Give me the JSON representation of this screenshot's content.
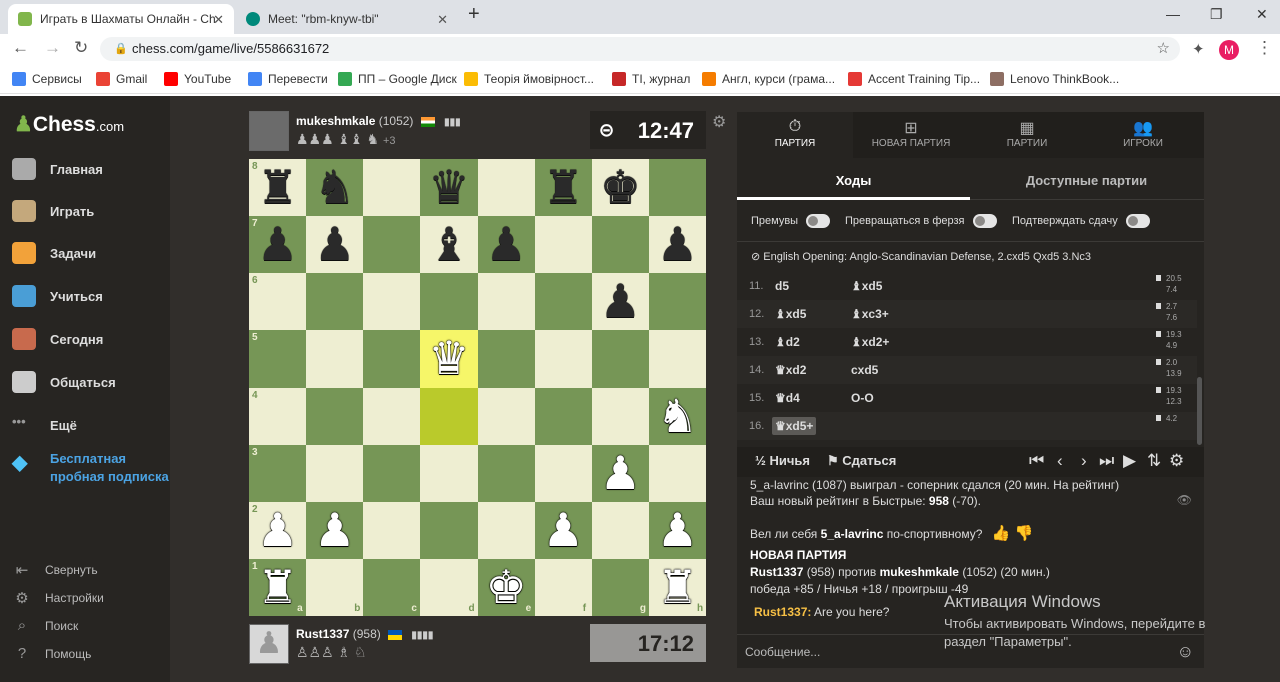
{
  "browser": {
    "tabs": [
      {
        "title": "Играть в Шахматы Онлайн - Ch",
        "close": "✕"
      },
      {
        "title": "Meet: \"rbm-knyw-tbi\"",
        "close": "✕"
      }
    ],
    "new_tab": "+",
    "url": "chess.com/game/live/5586631672",
    "profile_initial": "M",
    "bookmarks": [
      "Сервисы",
      "Gmail",
      "YouTube",
      "Перевести",
      "ПП – Google Диск",
      "Теорія ймовірност...",
      "TI, журнал",
      "Англ, курси (грама...",
      "Accent Training Tip...",
      "Lenovo ThinkBook..."
    ],
    "bookmark_colors": [
      "#4285f4",
      "#ea4335",
      "#ff0000",
      "#4285f4",
      "#34a853",
      "#fbbc04",
      "#c62828",
      "#f57c00",
      "#e53935",
      "#8d6e63"
    ]
  },
  "sidebar": {
    "logo_main": "Chess",
    "logo_suffix": ".com",
    "items": [
      {
        "label": "Главная",
        "color": "#aaaaaa"
      },
      {
        "label": "Играть",
        "color": "#c4a87c"
      },
      {
        "label": "Задачи",
        "color": "#f2a23a"
      },
      {
        "label": "Учиться",
        "color": "#4a9ed6"
      },
      {
        "label": "Сегодня",
        "color": "#c86a4d"
      },
      {
        "label": "Общаться",
        "color": "#cccccc"
      },
      {
        "label": "Ещё",
        "color": "#999999"
      }
    ],
    "promo": [
      "Бесплатная",
      "пробная подписка"
    ],
    "bottom": [
      "Свернуть",
      "Настройки",
      "Поиск",
      "Помощь"
    ]
  },
  "top_player": {
    "name": "mukeshmkale",
    "rating": "(1052)",
    "captured": "♟♟♟ ♝♝ ♞",
    "advantage": "+3",
    "clock": "12:47"
  },
  "bottom_player": {
    "name": "Rust1337",
    "rating": "(958)",
    "captured": "♙♙♙ ♗ ♘",
    "clock": "17:12"
  },
  "board": {
    "ranks": [
      "8",
      "7",
      "6",
      "5",
      "4",
      "3",
      "2",
      "1"
    ],
    "files": [
      "a",
      "b",
      "c",
      "d",
      "e",
      "f",
      "g",
      "h"
    ],
    "highlights": [
      "d5",
      "d4"
    ],
    "pieces": [
      {
        "sq": "a8",
        "p": "♜",
        "c": "b"
      },
      {
        "sq": "b8",
        "p": "♞",
        "c": "b"
      },
      {
        "sq": "d8",
        "p": "♛",
        "c": "b"
      },
      {
        "sq": "f8",
        "p": "♜",
        "c": "b"
      },
      {
        "sq": "g8",
        "p": "♚",
        "c": "b"
      },
      {
        "sq": "a7",
        "p": "♟",
        "c": "b"
      },
      {
        "sq": "b7",
        "p": "♟",
        "c": "b"
      },
      {
        "sq": "d7",
        "p": "♝",
        "c": "b"
      },
      {
        "sq": "e7",
        "p": "♟",
        "c": "b"
      },
      {
        "sq": "h7",
        "p": "♟",
        "c": "b"
      },
      {
        "sq": "g6",
        "p": "♟",
        "c": "b"
      },
      {
        "sq": "d5",
        "p": "♛",
        "c": "w"
      },
      {
        "sq": "h4",
        "p": "♞",
        "c": "w"
      },
      {
        "sq": "g3",
        "p": "♟",
        "c": "w"
      },
      {
        "sq": "a2",
        "p": "♟",
        "c": "w"
      },
      {
        "sq": "b2",
        "p": "♟",
        "c": "w"
      },
      {
        "sq": "f2",
        "p": "♟",
        "c": "w"
      },
      {
        "sq": "h2",
        "p": "♟",
        "c": "w"
      },
      {
        "sq": "a1",
        "p": "♜",
        "c": "w"
      },
      {
        "sq": "e1",
        "p": "♚",
        "c": "w"
      },
      {
        "sq": "h1",
        "p": "♜",
        "c": "w"
      }
    ]
  },
  "panel": {
    "tabs": [
      {
        "label": "ПАРТИЯ",
        "icon": "⏱"
      },
      {
        "label": "НОВАЯ ПАРТИЯ",
        "icon": "⊞"
      },
      {
        "label": "ПАРТИИ",
        "icon": "▦"
      },
      {
        "label": "ИГРОКИ",
        "icon": "👥"
      }
    ],
    "subtabs": [
      "Ходы",
      "Доступные партии"
    ],
    "toggles": [
      "Премувы",
      "Превращаться в ферзя",
      "Подтверждать сдачу"
    ],
    "opening": "English Opening: Anglo-Scandinavian Defense, 2.cxd5 Qxd5 3.Nc3",
    "moves": [
      {
        "n": "11.",
        "w": "d5",
        "b": "♝xd5",
        "t1": "20.5",
        "t2": "7.4"
      },
      {
        "n": "12.",
        "w": "♝xd5",
        "b": "♝xc3+",
        "t1": "2.7",
        "t2": "7.6"
      },
      {
        "n": "13.",
        "w": "♝d2",
        "b": "♝xd2+",
        "t1": "19.3",
        "t2": "4.9"
      },
      {
        "n": "14.",
        "w": "♛xd2",
        "b": "cxd5",
        "t1": "2.0",
        "t2": "13.9"
      },
      {
        "n": "15.",
        "w": "♛d4",
        "b": "O-O",
        "t1": "19.3",
        "t2": "12.3"
      },
      {
        "n": "16.",
        "w": "♛xd5+",
        "b": "",
        "t1": "4.2",
        "t2": ""
      }
    ],
    "draw": "Ничья",
    "draw_icon": "½",
    "resign": "Сдаться",
    "resign_icon": "⚑",
    "nav_icons": [
      "⏮",
      "‹",
      "›",
      "⏭",
      "▶",
      "⇅",
      "⚙"
    ],
    "chat": {
      "result": "5_a-lavrinc (1087) выиграл - соперник сдался (20 мин. На рейтинг)",
      "rating_prefix": "Ваш новый рейтинг в Быстрые:",
      "rating_value": "958",
      "rating_change": "(-70).",
      "sport_q_a": "Вел ли себя",
      "sport_q_name": "5_a-lavrinc",
      "sport_q_b": "по-спортивному?",
      "new_game": "НОВАЯ ПАРТИЯ",
      "vs_a": "Rust1337",
      "vs_b": "(958) против",
      "vs_c": "mukeshmkale",
      "vs_d": "(1052) (20 мин.)",
      "stakes": "победа +85 / Ничья +18 / проигрыш -49",
      "msg_user": "Rust1337:",
      "msg_text": "Are you here?",
      "input_placeholder": "Сообщение..."
    }
  },
  "windows_watermark": {
    "title": "Активация Windows",
    "line1": "Чтобы активировать Windows, перейдите в",
    "line2": "раздел \"Параметры\"."
  }
}
